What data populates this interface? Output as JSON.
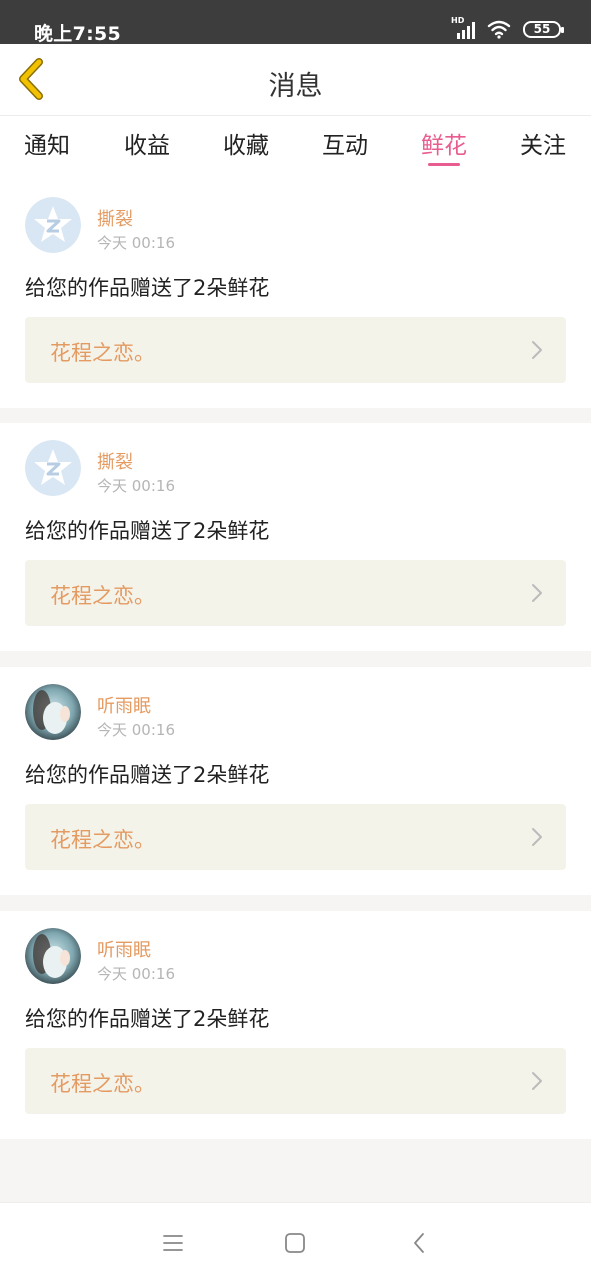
{
  "status_bar": {
    "time": "晚上7:55",
    "hd": "HD",
    "battery": "55"
  },
  "header": {
    "title": "消息",
    "back_icon": "chevron-left-icon"
  },
  "tabs": [
    {
      "label": "通知",
      "active": false
    },
    {
      "label": "收益",
      "active": false
    },
    {
      "label": "收藏",
      "active": false
    },
    {
      "label": "互动",
      "active": false
    },
    {
      "label": "鲜花",
      "active": true
    },
    {
      "label": "关注",
      "active": false
    }
  ],
  "messages": [
    {
      "user": "撕裂",
      "time": "今天 00:16",
      "text": "给您的作品赠送了2朵鲜花",
      "work": "花程之恋。",
      "avatar": "default-star-avatar"
    },
    {
      "user": "撕裂",
      "time": "今天 00:16",
      "text": "给您的作品赠送了2朵鲜花",
      "work": "花程之恋。",
      "avatar": "default-star-avatar"
    },
    {
      "user": "听雨眠",
      "time": "今天 00:16",
      "text": "给您的作品赠送了2朵鲜花",
      "work": "花程之恋。",
      "avatar": "photo-avatar"
    },
    {
      "user": "听雨眠",
      "time": "今天 00:16",
      "text": "给您的作品赠送了2朵鲜花",
      "work": "花程之恋。",
      "avatar": "photo-avatar"
    }
  ],
  "colors": {
    "accent": "#e85c8f",
    "username": "#e49b62",
    "link_bg": "#f4f3ea",
    "page_bg": "#f7f5f4",
    "back_arrow": "#f2c200"
  },
  "nav_bar": {
    "menu_icon": "menu-icon",
    "home_icon": "home-square-icon",
    "back_icon": "back-triangle-icon"
  }
}
